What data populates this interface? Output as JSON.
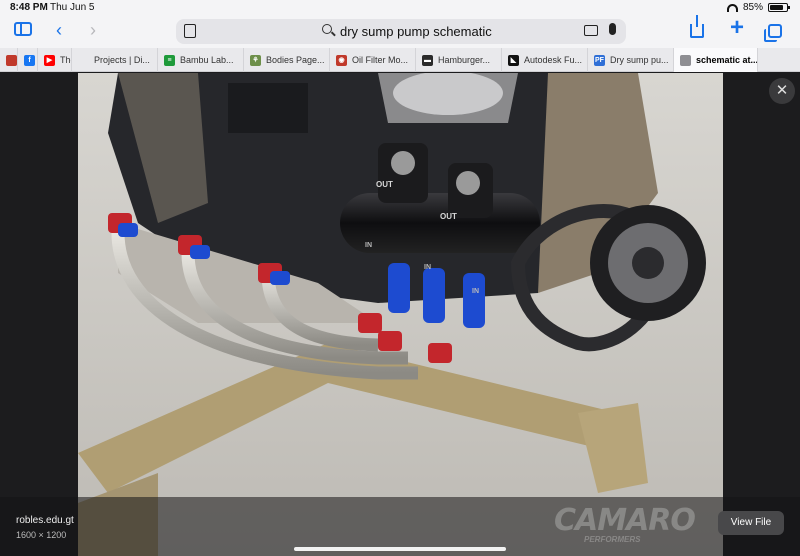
{
  "status": {
    "time": "8:48 PM",
    "date": "Thu Jun 5",
    "battery": "85%",
    "battery_level": 0.85
  },
  "toolbar": {
    "search_query": "dry sump pump schematic"
  },
  "tabs": [
    {
      "label": "",
      "favicon": "bookmark",
      "color": "#c0392b",
      "active": false
    },
    {
      "label": "",
      "favicon": "facebook",
      "color": "#1877f2",
      "active": false
    },
    {
      "label": "The S",
      "favicon": "youtube",
      "color": "#ff0000",
      "active": false
    },
    {
      "label": "Projects | Di...",
      "favicon": "blank",
      "color": "#e9e9ec",
      "active": false
    },
    {
      "label": "Bambu Lab...",
      "favicon": "bambu",
      "color": "#1e9a3a",
      "active": false
    },
    {
      "label": "Bodies Page...",
      "favicon": "plant",
      "color": "#6d8f4a",
      "active": false
    },
    {
      "label": "Oil Filter Mo...",
      "favicon": "oil",
      "color": "#c0392b",
      "active": false
    },
    {
      "label": "Hamburger...",
      "favicon": "burger",
      "color": "#2b2b2b",
      "active": false
    },
    {
      "label": "Autodesk Fu...",
      "favicon": "autodesk",
      "color": "#111111",
      "active": false
    },
    {
      "label": "Dry sump pu...",
      "favicon": "PF",
      "color": "#2f6fd6",
      "active": false
    },
    {
      "label": "schematic at...",
      "favicon": "close",
      "color": "#8e8e93",
      "active": true
    }
  ],
  "viewer": {
    "source_site": "robles.edu.gt",
    "image_dimensions": "1600 × 1200",
    "view_file_label": "View File",
    "watermark": "CAMARO",
    "watermark_sub": "PERFORMERS",
    "photo_stamps": [
      "OUT",
      "OUT",
      "IN",
      "IN",
      "IN"
    ]
  }
}
